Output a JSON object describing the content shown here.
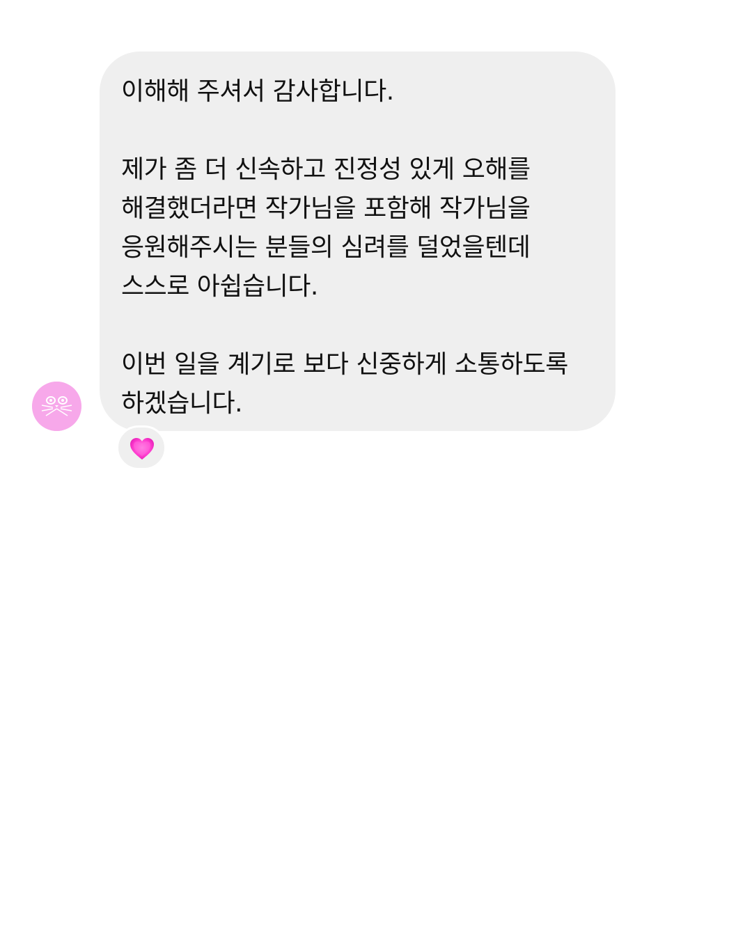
{
  "message": {
    "lines": [
      "이해해 주셔서 감사합니다.",
      "",
      "제가 좀 더 신속하고 진정성 있게 오해를",
      "해결했더라면 작가님을 포함해 작가님을",
      "응원해주시는 분들의 심려를 덜었을텐데",
      "스스로 아쉽습니다.",
      "",
      "이번 일을 계기로 보다 신중하게 소통하도록",
      "하겠습니다."
    ]
  },
  "sender": {
    "avatar_icon": "pink-cat-face-icon",
    "avatar_color": "#f7a8ea"
  },
  "reaction": {
    "icon": "pink-heart-icon",
    "color": "#ff3fd0"
  },
  "colors": {
    "bubble_background": "#efefef",
    "text": "#111111",
    "page_background": "#ffffff"
  }
}
